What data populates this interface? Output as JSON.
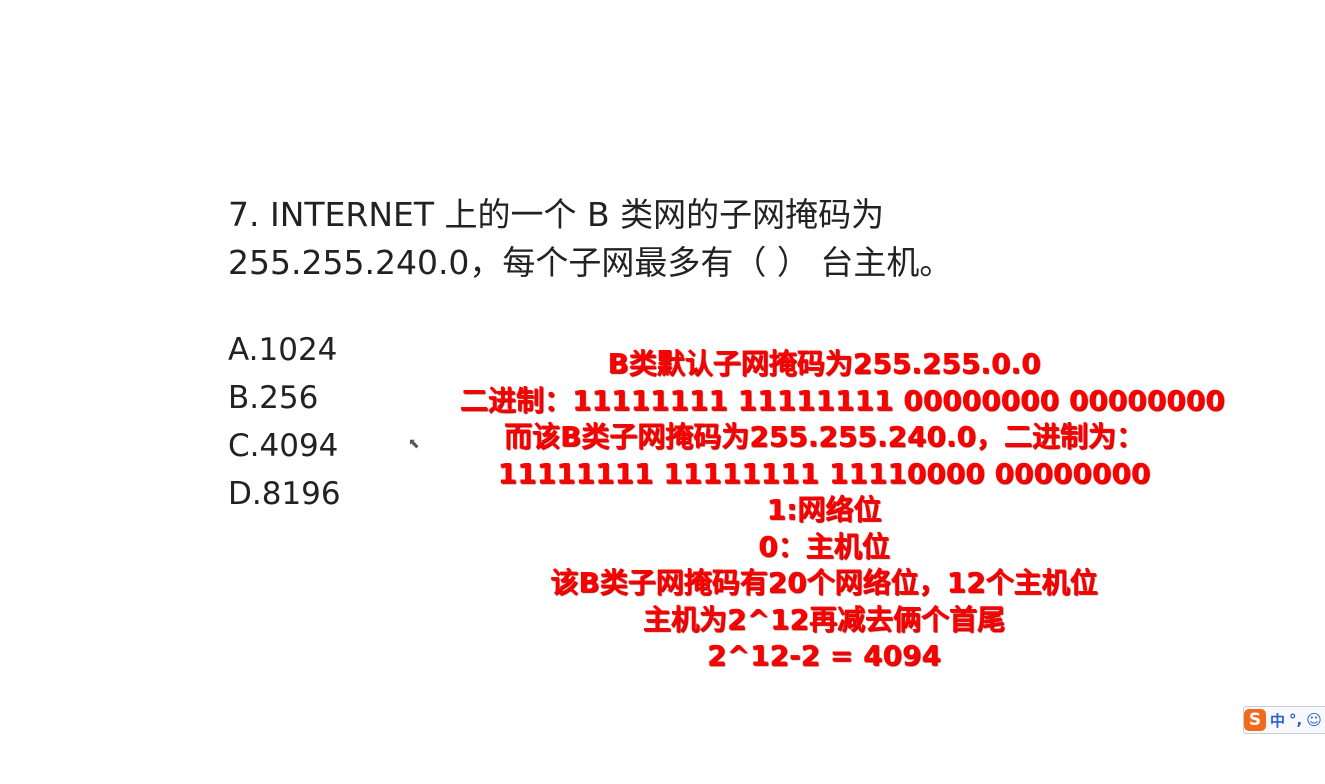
{
  "question": {
    "line1": "7.  INTERNET 上的一个 B 类网的子网掩码为",
    "line2": "255.255.240.0，每个子网最多有（  ）  台主机。"
  },
  "options": [
    "A.1024",
    "B.256",
    "C.4094",
    "D.8196"
  ],
  "annotation": [
    "B类默认子网掩码为255.255.0.0",
    "二进制：11111111  11111111  00000000  00000000",
    "而该B类子网掩码为255.255.240.0，二进制为：",
    "11111111  11111111  11110000  00000000",
    "1:网络位",
    "0：主机位",
    "该B类子网掩码有20个网络位，12个主机位",
    "主机为2^12再减去俩个首尾",
    "2^12-2 = 4094"
  ],
  "ime": {
    "logo": "S",
    "mode": "中",
    "punct": "°,",
    "emoji": "☺"
  }
}
